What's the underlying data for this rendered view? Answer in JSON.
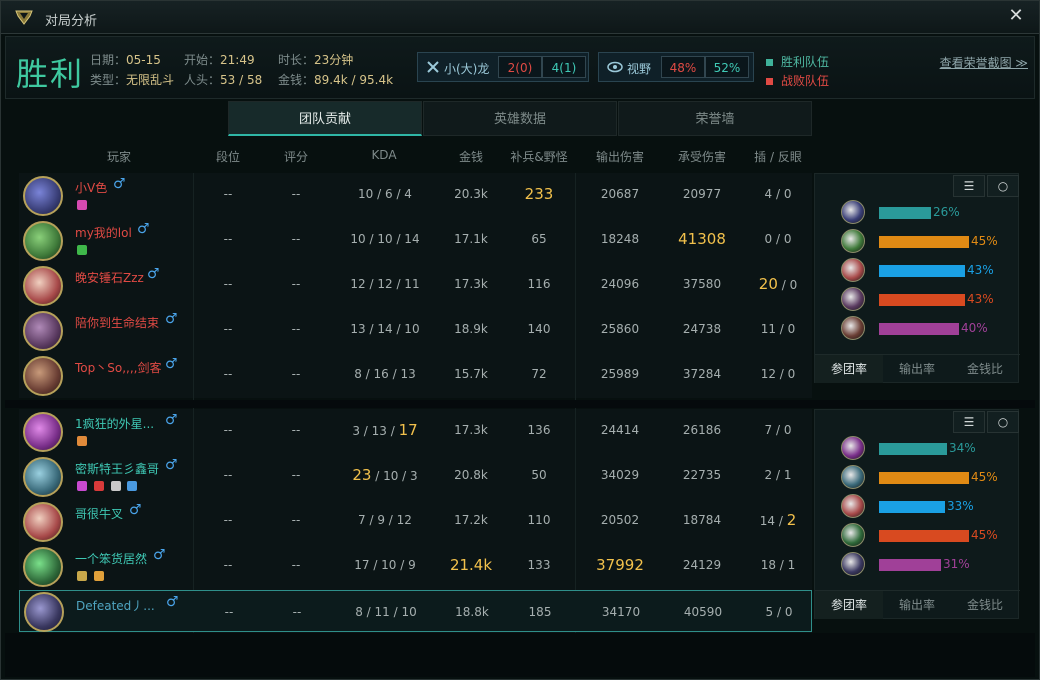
{
  "window": {
    "title": "对局分析",
    "close_symbol": "✕"
  },
  "summary": {
    "result": "胜利",
    "date_label": "日期：",
    "date": "05-15",
    "start_label": "开始：",
    "start": "21:49",
    "duration_label": "时长：",
    "duration": "23分钟",
    "type_label": "类型：",
    "type": "无限乱斗",
    "kills_label": "人头：",
    "kills": "53 / 58",
    "gold_label": "金钱：",
    "gold": "89.4k / 95.4k",
    "dragon_label": "小(大)龙",
    "dragon_lose": "2(0)",
    "dragon_win": "4(1)",
    "vision_label": "视野",
    "vision_lose": "48%",
    "vision_win": "52%",
    "legend_win": "胜利队伍",
    "legend_lose": "战败队伍",
    "legend_win_color": "#3fb29a",
    "legend_lose_color": "#e04a44",
    "honor_link": "查看荣誉截图 ≫"
  },
  "tabs": [
    "团队贡献",
    "英雄数据",
    "荣誉墙"
  ],
  "columns": [
    "玩家",
    "段位",
    "评分",
    "KDA",
    "金钱",
    "补兵&野怪",
    "输出伤害",
    "承受伤害",
    "插 / 反眼"
  ],
  "team_lose": [
    {
      "name": "小V色",
      "rank": "--",
      "score": "--",
      "kda": "10 / 6 / 4",
      "gold": "20.3k",
      "cs": "233",
      "dmg": "20687",
      "taken": "20977",
      "wards": "4 / 0",
      "avatar": "#3a3f78"
    },
    {
      "name": "my我的lol",
      "rank": "--",
      "score": "--",
      "kda": "10 / 10 / 14",
      "gold": "17.1k",
      "cs": "65",
      "dmg": "18248",
      "taken": "41308",
      "wards": "0 / 0",
      "avatar": "#3f7a3a"
    },
    {
      "name": "晚安锤石Zzz",
      "rank": "--",
      "score": "--",
      "kda": "12 / 12 / 11",
      "gold": "17.3k",
      "cs": "116",
      "dmg": "24096",
      "taken": "37580",
      "wards_a": "20",
      "wards_b": " / 0",
      "avatar": "#a84a4a"
    },
    {
      "name": "陪你到生命结束",
      "rank": "--",
      "score": "--",
      "kda": "13 / 14 / 10",
      "gold": "18.9k",
      "cs": "140",
      "dmg": "25860",
      "taken": "24738",
      "wards": "11 / 0",
      "avatar": "#5a3a60"
    },
    {
      "name": "Top丶So,,,,剑客",
      "rank": "--",
      "score": "--",
      "kda": "8 / 16 / 13",
      "gold": "15.7k",
      "cs": "72",
      "dmg": "25989",
      "taken": "37284",
      "wards": "12 / 0",
      "avatar": "#6a3e34"
    }
  ],
  "team_win": [
    {
      "name": "1疯狂的外星...",
      "rank": "--",
      "score": "--",
      "kda_a": "3 / 13 / ",
      "kda_b": "17",
      "gold": "17.3k",
      "cs": "136",
      "dmg": "24414",
      "taken": "26186",
      "wards": "7 / 0",
      "avatar": "#7a2f8a"
    },
    {
      "name": "密斯特王彡鑫哥",
      "rank": "--",
      "score": "--",
      "kda_a": "23",
      "kda_b": " / 10 / 3",
      "gold": "20.8k",
      "cs": "50",
      "dmg": "34029",
      "taken": "22735",
      "wards": "2 / 1",
      "avatar": "#3a6a7a"
    },
    {
      "name": "哥很牛叉",
      "rank": "--",
      "score": "--",
      "kda": "7 / 9 / 12",
      "gold": "17.2k",
      "cs": "110",
      "dmg": "20502",
      "taken": "18784",
      "wards_a": "14 / ",
      "wards_b": "2",
      "avatar": "#a84a4a"
    },
    {
      "name": "一个笨货居然",
      "rank": "--",
      "score": "--",
      "kda": "17 / 10 / 9",
      "gold": "21.4k",
      "cs": "133",
      "dmg": "37992",
      "taken": "24129",
      "wards": "18 / 1",
      "avatar": "#2f6a3a"
    },
    {
      "name": "Defeated丿...",
      "rank": "--",
      "score": "--",
      "kda": "8 / 11 / 10",
      "gold": "18.8k",
      "cs": "185",
      "dmg": "34170",
      "taken": "40590",
      "wards": "5 / 0",
      "avatar": "#3a3860"
    }
  ],
  "side_lose": {
    "bars": [
      {
        "pct": "26%",
        "value": 26,
        "color": "#2a9a9a",
        "avatar": "#3a3f78"
      },
      {
        "pct": "45%",
        "value": 45,
        "color": "#e08a14",
        "avatar": "#3f7a3a"
      },
      {
        "pct": "43%",
        "value": 43,
        "color": "#1aa0e4",
        "avatar": "#a84a4a"
      },
      {
        "pct": "43%",
        "value": 43,
        "color": "#d84a20",
        "avatar": "#5a3a60"
      },
      {
        "pct": "40%",
        "value": 40,
        "color": "#a04098",
        "avatar": "#6a3e34"
      }
    ],
    "subtabs": [
      "参团率",
      "输出率",
      "金钱比"
    ]
  },
  "side_win": {
    "bars": [
      {
        "pct": "34%",
        "value": 34,
        "color": "#2a9a9a",
        "avatar": "#7a2f8a"
      },
      {
        "pct": "45%",
        "value": 45,
        "color": "#e08a14",
        "avatar": "#3a6a7a"
      },
      {
        "pct": "33%",
        "value": 33,
        "color": "#1aa0e4",
        "avatar": "#a84a4a"
      },
      {
        "pct": "45%",
        "value": 45,
        "color": "#d84a20",
        "avatar": "#2f6a3a"
      },
      {
        "pct": "31%",
        "value": 31,
        "color": "#a04098",
        "avatar": "#3a3860"
      }
    ],
    "subtabs": [
      "参团率",
      "输出率",
      "金钱比"
    ]
  }
}
